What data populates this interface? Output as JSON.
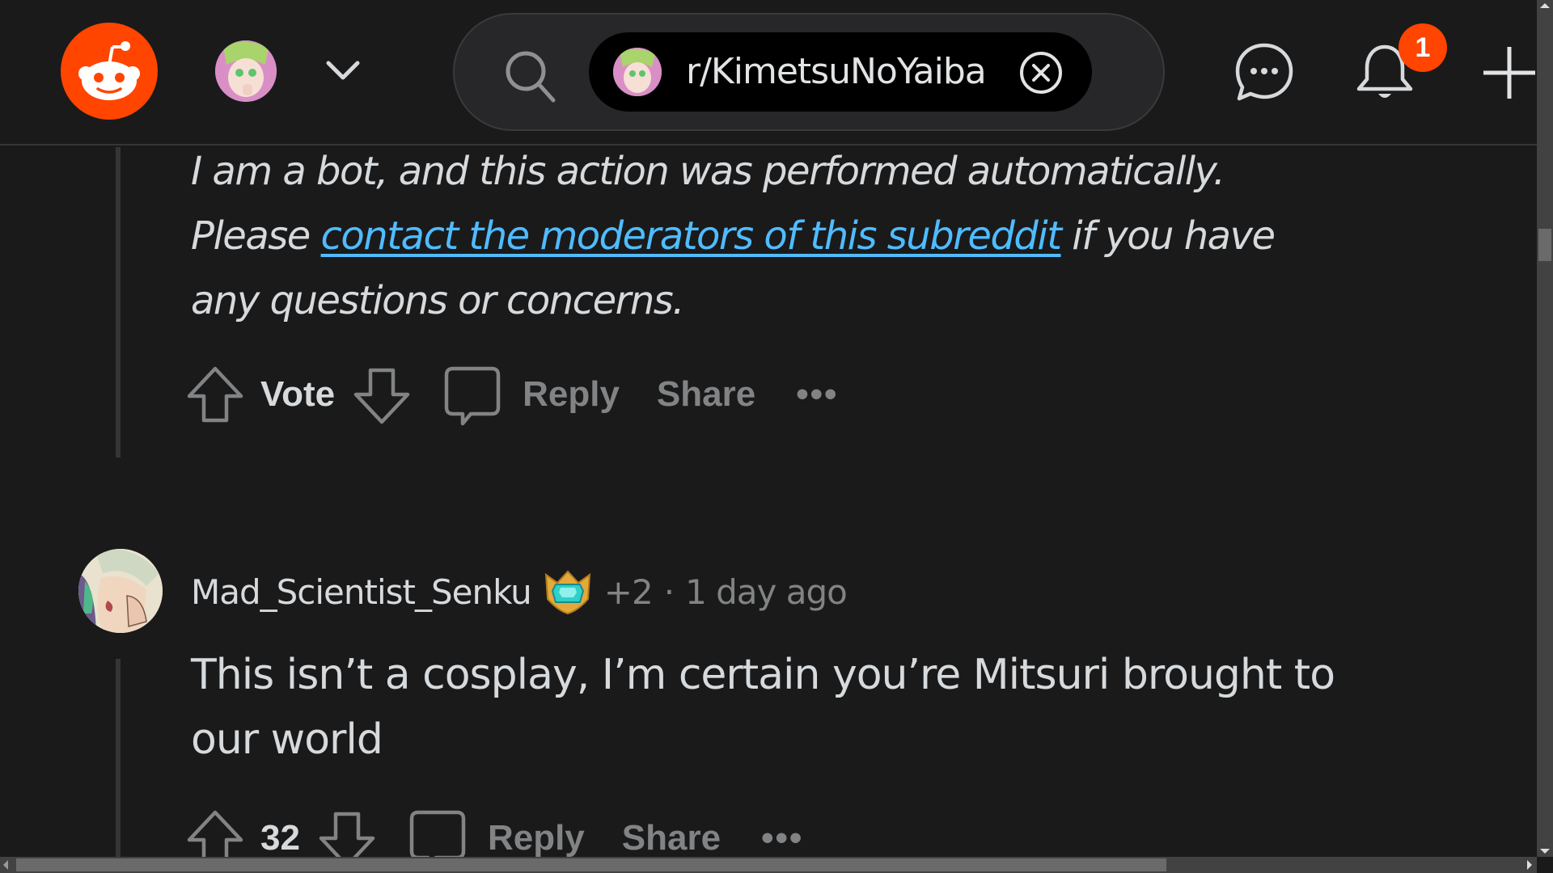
{
  "header": {
    "logo": "reddit-logo",
    "user_avatar": "user-avatar",
    "account_menu_icon": "chevron-down-icon",
    "search": {
      "icon": "search-icon",
      "chip_label": "r/KimetsuNoYaiba",
      "chip_icon": "subreddit-avatar",
      "clear_icon": "close-circle-icon"
    },
    "chat_icon": "chat-icon",
    "notifications_icon": "bell-icon",
    "notification_count": "1",
    "create_icon": "plus-icon"
  },
  "colors": {
    "brand": "#ff4500",
    "link": "#4fbcff",
    "background": "#1a1a1b",
    "text": "#d7dadc",
    "muted": "#818384"
  },
  "comments": [
    {
      "type": "bot",
      "body_line1": "I am a bot, and this action was performed automatically.",
      "body_prefix": "Please ",
      "body_link": "contact the moderators of this subreddit",
      "body_suffix": " if you have any questions or concerns.",
      "actions": {
        "vote_label": "Vote",
        "reply_label": "Reply",
        "share_label": "Share",
        "more_label": "•••"
      }
    },
    {
      "type": "user",
      "username": "Mad_Scientist_Senku",
      "flair": "gem-flair-icon",
      "karma": "+2",
      "separator": "·",
      "time": "1 day ago",
      "body": "This isn’t a cosplay, I’m certain you’re Mitsuri brought to our world",
      "actions": {
        "vote_label": "32",
        "reply_label": "Reply",
        "share_label": "Share",
        "more_label": "•••"
      }
    }
  ]
}
